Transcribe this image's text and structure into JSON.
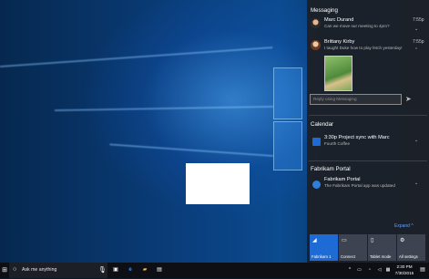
{
  "messaging": {
    "section_title": "Messaging",
    "notifications": [
      {
        "name": "Marc Durand",
        "text": "Can we move our meeting to 4pm?",
        "time": "7:55p"
      },
      {
        "name": "Brittany Kirby",
        "text": "I taught Duke how to play fetch yesterday!",
        "time": "7:55p"
      }
    ],
    "reply_placeholder": "Reply using Messaging"
  },
  "calendar": {
    "section_title": "Calendar",
    "event_title": "3:30p  Project sync with Marc",
    "event_location": "Fourth Coffee"
  },
  "portal": {
    "section_title": "Fabrikam Portal",
    "title": "Fabrikam Portal",
    "text": "The Fabrikam Portal app was updated"
  },
  "expand_label": "Expand ^",
  "quick_actions": [
    {
      "label": "Fabrikam 1",
      "icon": "network-icon"
    },
    {
      "label": "Connect",
      "icon": "connect-icon"
    },
    {
      "label": "Tablet mode",
      "icon": "tablet-icon"
    },
    {
      "label": "All settings",
      "icon": "gear-icon"
    }
  ],
  "taskbar": {
    "search_placeholder": "Ask me anything",
    "time": "2:30 PM",
    "date": "7/30/2015"
  },
  "colors": {
    "accent": "#1e6bd6",
    "action_center_bg": "#1c2028",
    "taskbar_bg": "#0d0f14"
  }
}
